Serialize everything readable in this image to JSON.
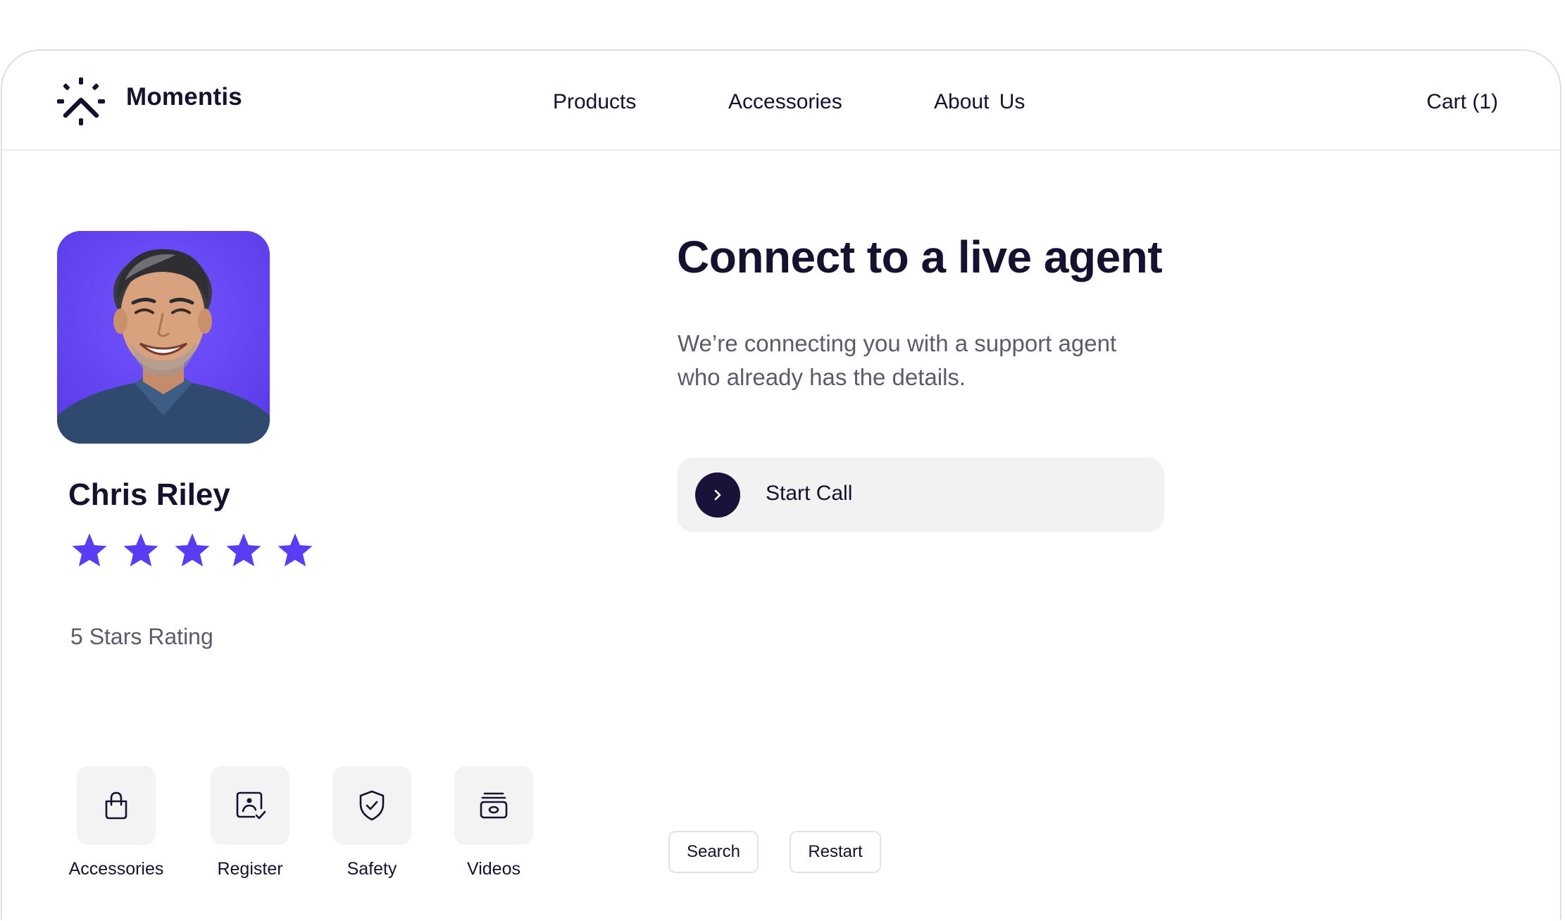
{
  "header": {
    "brand": "Momentis",
    "nav": {
      "products": "Products",
      "accessories": "Accessories",
      "about": "About Us"
    },
    "cart": "Cart (1)"
  },
  "agent": {
    "name": "Chris Riley",
    "rating": 5,
    "rating_max": 5,
    "rating_text": "5 Stars Rating"
  },
  "quick_links": [
    {
      "label": "Accessories",
      "icon": "shopping-bag-icon"
    },
    {
      "label": "Register",
      "icon": "image-check-icon"
    },
    {
      "label": "Safety",
      "icon": "shield-check-icon"
    },
    {
      "label": "Videos",
      "icon": "video-stack-icon"
    }
  ],
  "main": {
    "title": "Connect to a live agent",
    "subtitle": "We’re connecting you with a support agent who already has the details.",
    "call_button": "Start Call"
  },
  "actions": {
    "search": "Search",
    "restart": "Restart"
  },
  "colors": {
    "accent": "#5b3cf5",
    "ink": "#16112e",
    "muted": "#5d5a6b",
    "surface": "#f2f2f3"
  }
}
